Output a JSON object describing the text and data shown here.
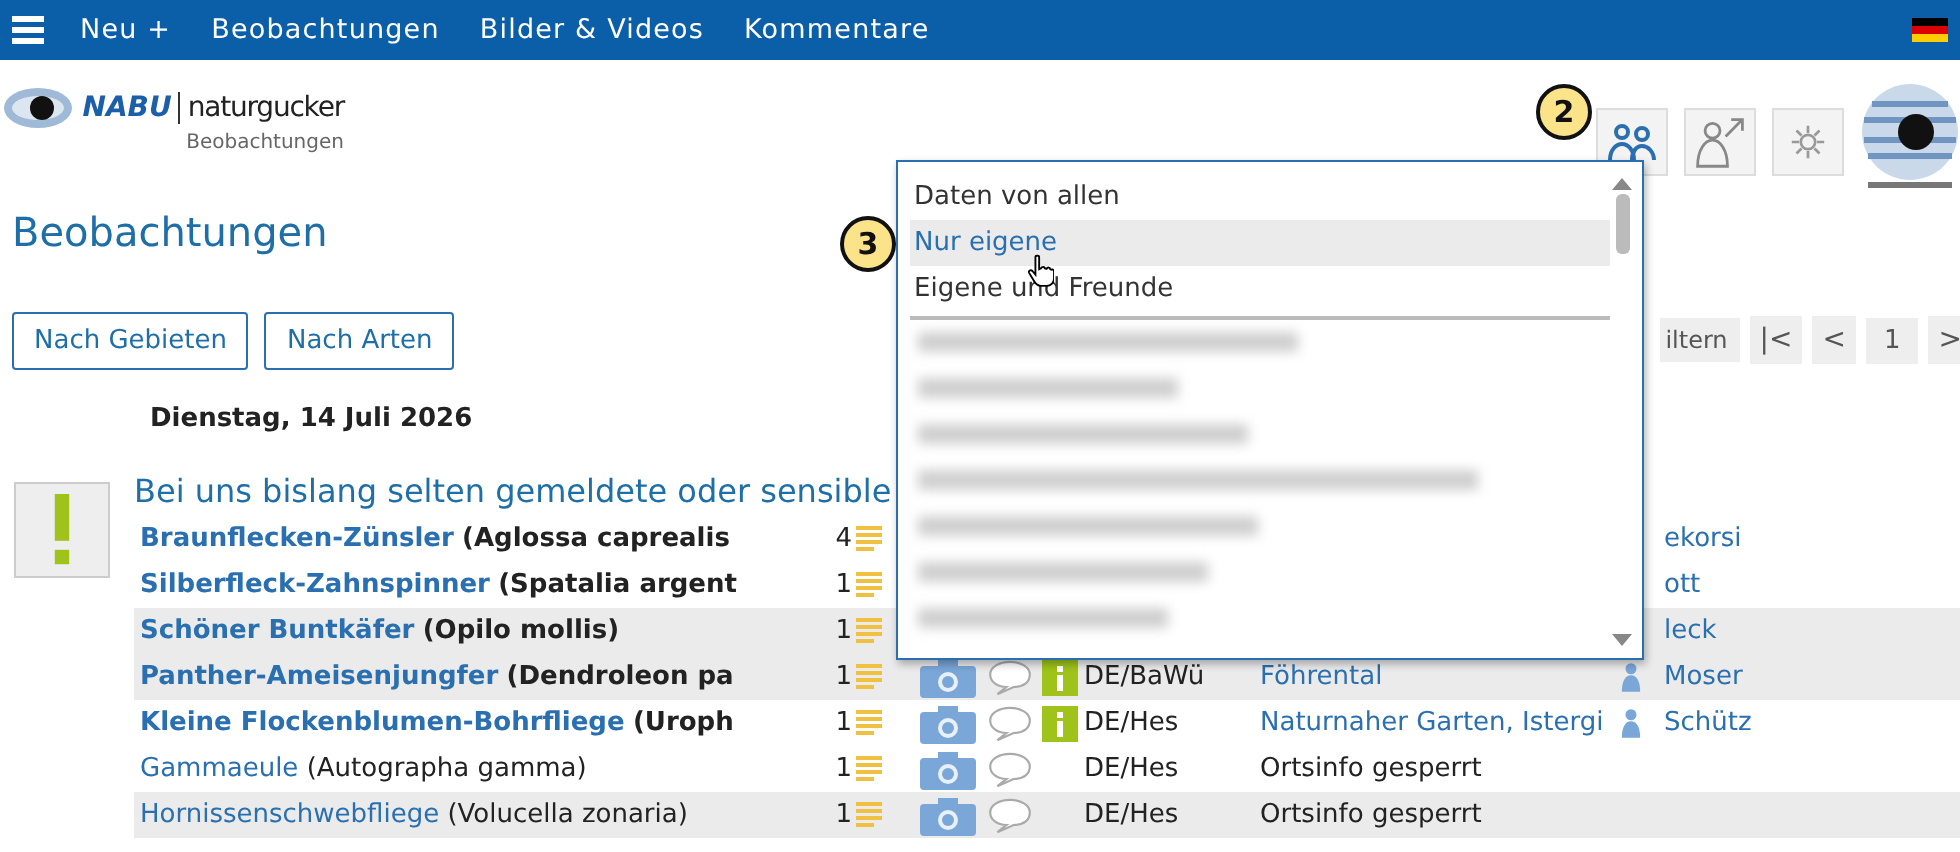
{
  "nav": {
    "items": [
      "Neu +",
      "Beobachtungen",
      "Bilder & Videos",
      "Kommentare"
    ]
  },
  "logo": {
    "brand": "NABU",
    "product": "naturgucker",
    "subtitle": "Beobachtungen"
  },
  "title": "Beobachtungen",
  "view_buttons": [
    "Nach Gebieten",
    "Nach Arten"
  ],
  "pagination": {
    "filter_button": "iltern",
    "first": "|<",
    "prev": "<",
    "page": "1",
    "next": ">"
  },
  "date": "Dienstag, 14 Juli 2026",
  "alert": {
    "heading": "Bei uns bislang selten gemeldete oder sensible"
  },
  "rows": [
    {
      "name": "Braunflecken-Zünsler",
      "latin": "(Aglossa caprealis",
      "bold": true,
      "shaded": false,
      "count": "4",
      "observer": "ekorsi"
    },
    {
      "name": "Silberfleck-Zahnspinner",
      "latin": "(Spatalia argent",
      "bold": true,
      "shaded": false,
      "count": "1",
      "observer": "ott"
    },
    {
      "name": "Schöner Buntkäfer",
      "latin": "(Opilo mollis)",
      "bold": true,
      "shaded": true,
      "count": "1",
      "observer": "leck"
    },
    {
      "name": "Panther-Ameisenjungfer",
      "latin": "(Dendroleon pa",
      "bold": true,
      "shaded": true,
      "count": "1",
      "photo": true,
      "comment": true,
      "info": true,
      "region": "DE/BaWü",
      "location": "Föhrental",
      "location_link": true,
      "observer": "Moser",
      "person": true
    },
    {
      "name": "Kleine Flockenblumen-Bohrfliege",
      "latin": "(Uroph",
      "bold": true,
      "shaded": false,
      "count": "1",
      "photo": true,
      "comment": true,
      "info": true,
      "region": "DE/Hes",
      "location": "Naturnaher Garten, Istergi",
      "location_link": true,
      "observer": "Schütz",
      "person": true
    },
    {
      "name": "Gammaeule",
      "latin": "(Autographa gamma)",
      "bold": false,
      "shaded": false,
      "count": "1",
      "photo": true,
      "comment": true,
      "info": false,
      "region": "DE/Hes",
      "location": "Ortsinfo gesperrt",
      "location_link": false
    },
    {
      "name": "Hornissenschwebfliege",
      "latin": "(Volucella zonaria)",
      "bold": false,
      "shaded": true,
      "count": "1",
      "photo": true,
      "comment": true,
      "info": false,
      "region": "DE/Hes",
      "location": "Ortsinfo gesperrt",
      "location_link": false
    }
  ],
  "dropdown": {
    "options": [
      {
        "label": "Daten von allen",
        "selected": false
      },
      {
        "label": "Nur eigene",
        "selected": true
      },
      {
        "label": "Eigene und Freunde",
        "selected": false
      }
    ]
  },
  "annotations": [
    {
      "label": "2"
    },
    {
      "label": "3"
    }
  ]
}
